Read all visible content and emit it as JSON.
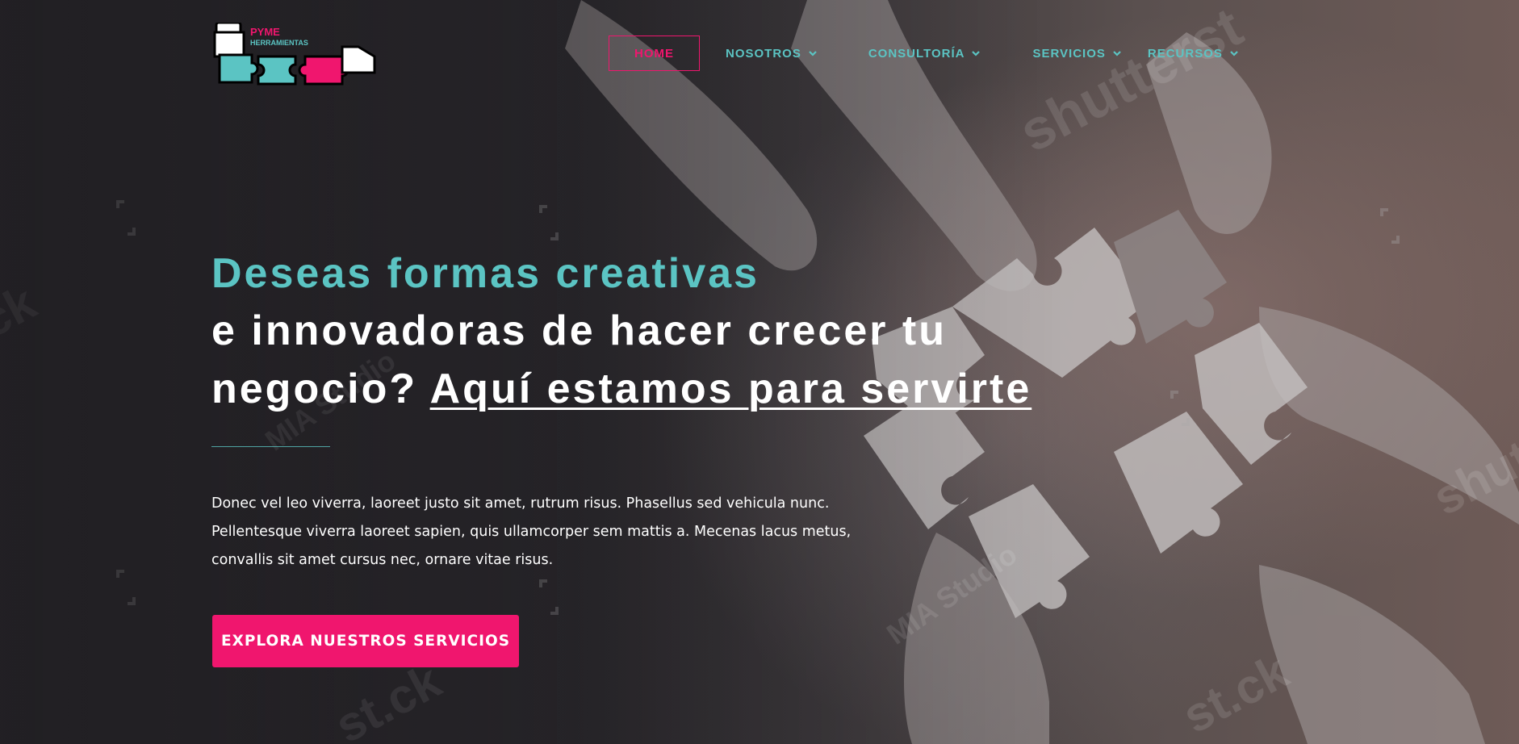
{
  "brand": {
    "logo_text_top": "PYME",
    "logo_text_bottom": "HERRAMIENTAS",
    "colors": {
      "teal": "#5bc4c3",
      "pink": "#f0166e",
      "dark": "#262428",
      "white": "#ffffff"
    }
  },
  "nav": {
    "items": [
      {
        "label": "HOME",
        "active": true
      },
      {
        "label": "NOSOTROS",
        "has_dropdown": true,
        "icon": "chevron-down-icon"
      },
      {
        "label": "CONSULTORÍA",
        "has_dropdown": true,
        "icon": "chevron-down-icon"
      },
      {
        "label": "SERVICIOS",
        "has_dropdown": true,
        "icon": "chevron-down-icon"
      },
      {
        "label": "RECURSOS",
        "has_dropdown": true,
        "icon": "chevron-down-icon"
      }
    ]
  },
  "hero": {
    "title_line1": "Deseas formas creativas",
    "title_line2": "e innovadoras de hacer crecer tu",
    "title_line3_prefix": "negocio? ",
    "title_link": "Aquí estamos para servirte",
    "body": "Donec vel leo viverra, laoreet justo sit amet, rutrum risus. Phasellus sed vehicula nunc. Pellentesque viverra laoreet sapien, quis ullamcorper sem mattis a. Mecenas lacus metus, convallis sit amet cursus nec, ornare vitae risus.",
    "cta_label": "EXPLORA NUESTROS SERVICIOS"
  },
  "background": {
    "watermarks": [
      "shutterst",
      "shutterst",
      "MIA Studio",
      "MIA Studio",
      "st.ck",
      "ck"
    ]
  }
}
